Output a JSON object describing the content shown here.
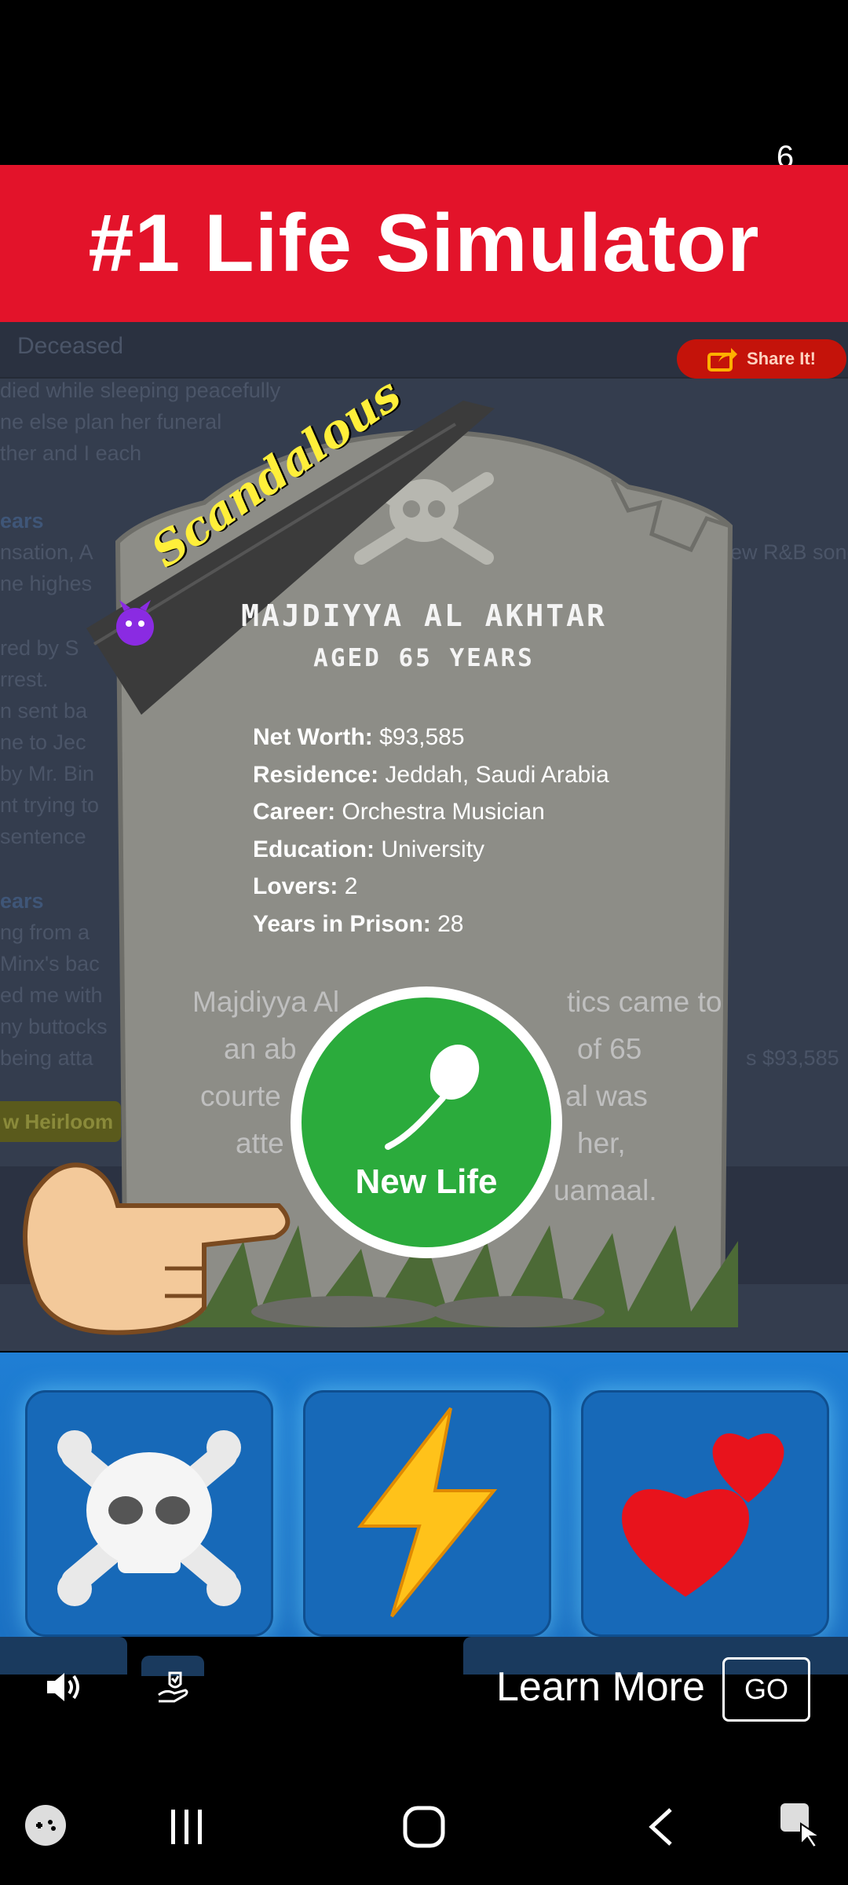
{
  "countdown": "6",
  "banner": {
    "title": "#1 Life Simulator"
  },
  "game": {
    "header_label": "Deceased",
    "share_label": "Share It!",
    "background_lines": [
      "died while sleeping peacefully",
      "ne else plan her funeral",
      "ther and I each",
      "ears",
      "nsation, A",
      "ne highes",
      "red by S",
      "rrest.",
      "n sent ba",
      "ne to Jec",
      "by Mr. Bin",
      "nt trying to",
      "sentence",
      "ears",
      "ng from a",
      "Minx's bac",
      "ed me with",
      "ny buttocks",
      "being atta"
    ],
    "right_fragments": {
      "rnb": "ew R&B song",
      "money": "s $93,585"
    },
    "heirloom_label": "w Heirloom"
  },
  "tombstone": {
    "ribbon_text": "Scandalous",
    "name": "MAJDIYYA AL AKHTAR",
    "age": "AGED 65 YEARS",
    "stats": [
      {
        "key": "Net Worth:",
        "value": "$93,585"
      },
      {
        "key": "Residence:",
        "value": "Jeddah, Saudi Arabia"
      },
      {
        "key": "Career:",
        "value": "Orchestra Musician"
      },
      {
        "key": "Education:",
        "value": "University"
      },
      {
        "key": "Lovers:",
        "value": "2"
      },
      {
        "key": "Years in Prison:",
        "value": "28"
      }
    ],
    "epitaph_lines": [
      "Majdiyya Al",
      "tics came to",
      "an ab",
      "of 65",
      "courte",
      "al was",
      "atte",
      "her,",
      "uamaal."
    ]
  },
  "new_life_button": {
    "label": "New Life"
  },
  "actions": [
    {
      "icon": "skull-crossbones-icon"
    },
    {
      "icon": "lightning-bolt-icon"
    },
    {
      "icon": "two-hearts-icon"
    }
  ],
  "ad": {
    "learn_more": "Learn More",
    "go": "GO"
  },
  "colors": {
    "banner_red": "#e3132a",
    "new_life_green": "#2bab3c",
    "action_blue": "#1f7ed4"
  }
}
